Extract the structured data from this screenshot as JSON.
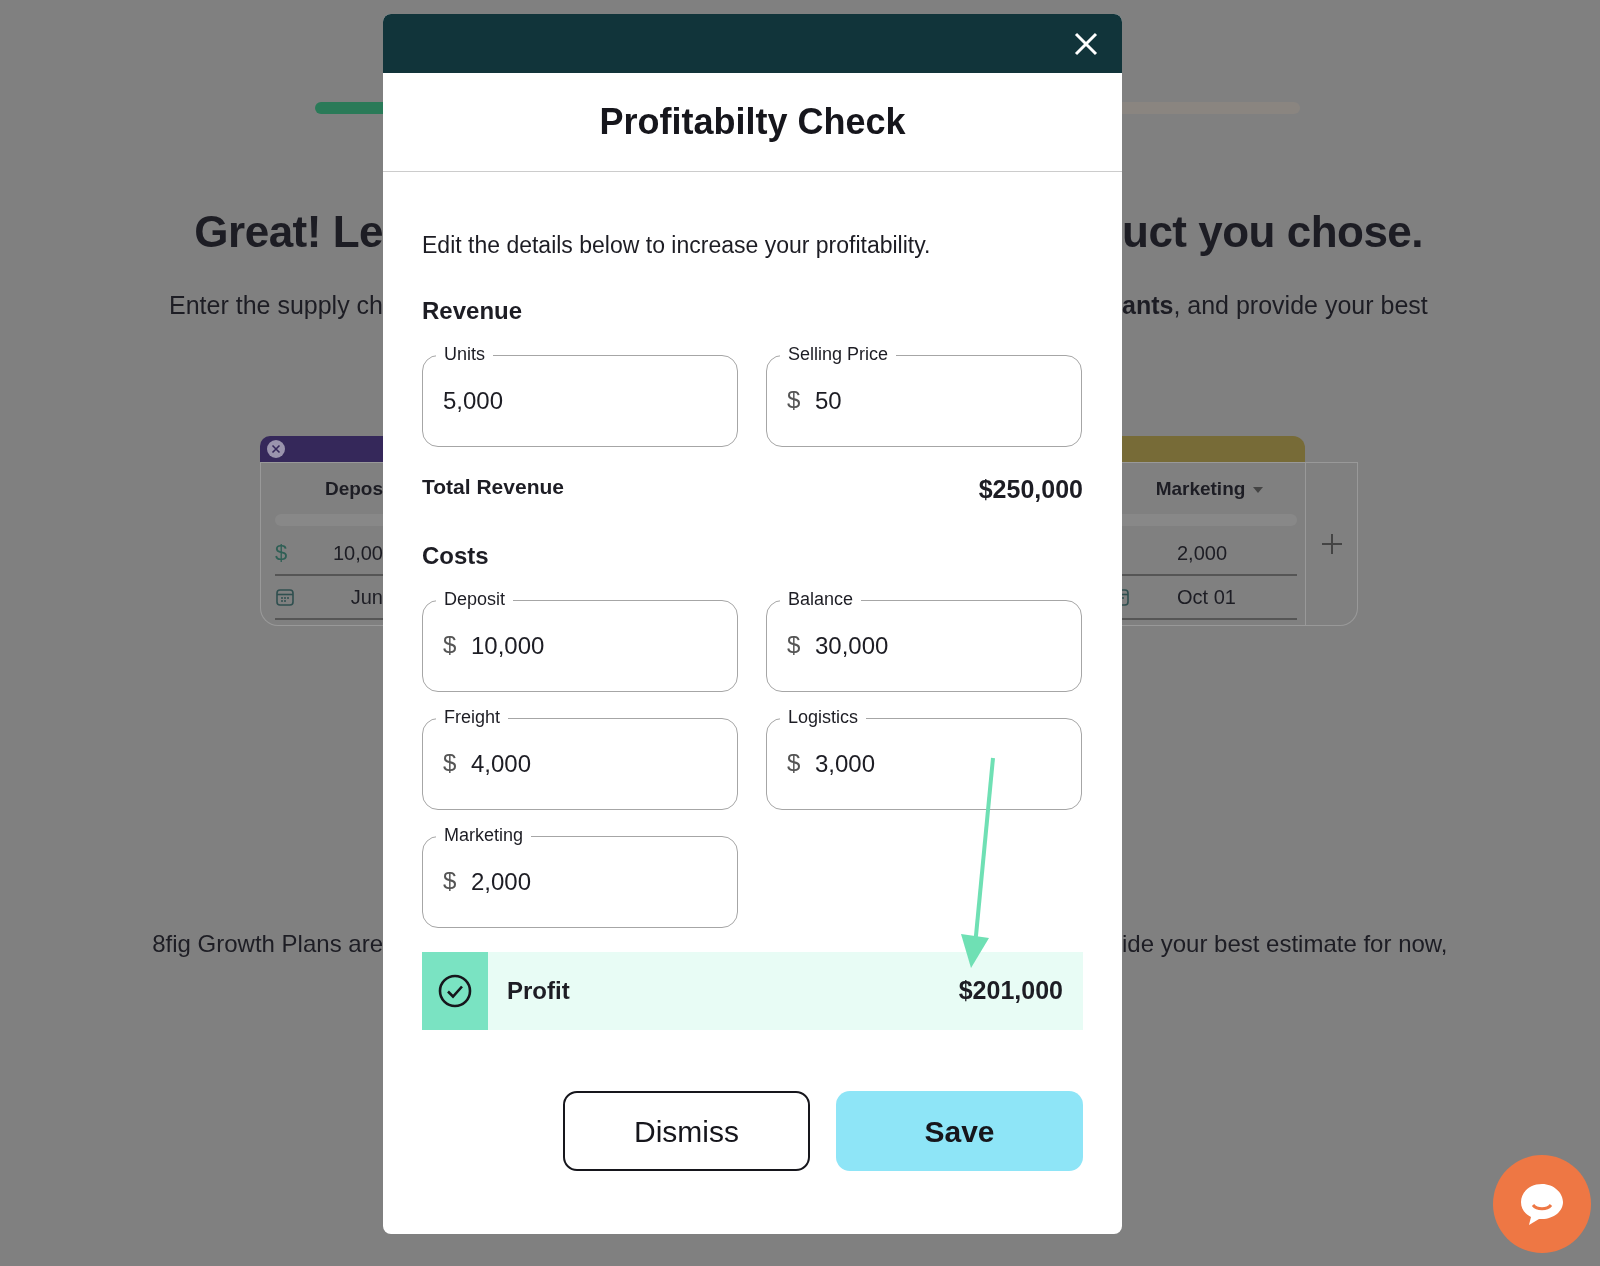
{
  "background": {
    "heading_left": "Great! Le",
    "heading_right": "uct you chose.",
    "subtitle_left": "Enter the supply ch",
    "subtitle_right": "**ants**, and provide your best",
    "footer_left": "8fig Growth Plans are",
    "footer_right": "ide your best estimate for now,",
    "card_left": {
      "column": "Depos",
      "currency": "$",
      "amount": "10,00",
      "date": "Jun"
    },
    "card_right": {
      "column": "Marketing",
      "amount": "2,000",
      "date": "Oct 01"
    }
  },
  "modal": {
    "title": "Profitabilty Check",
    "intro": "Edit the details below to increase your profitability.",
    "sections": [
      {
        "heading": "Revenue",
        "fields": [
          {
            "label": "Units",
            "value": "5,000"
          },
          {
            "label": "Selling Price",
            "prefix": "$",
            "value": "50"
          }
        ],
        "total": {
          "label": "Total Revenue",
          "value": "$250,000"
        }
      },
      {
        "heading": "Costs",
        "fields": [
          {
            "label": "Deposit",
            "prefix": "$",
            "value": "10,000"
          },
          {
            "label": "Balance",
            "prefix": "$",
            "value": "30,000"
          },
          {
            "label": "Freight",
            "prefix": "$",
            "value": "4,000"
          },
          {
            "label": "Logistics",
            "prefix": "$",
            "value": "3,000"
          },
          {
            "label": "Marketing",
            "prefix": "$",
            "value": "2,000"
          }
        ]
      }
    ],
    "profit": {
      "label": "Profit",
      "value": "$201,000"
    },
    "buttons": [
      {
        "label": "Dismiss",
        "kind": "outline"
      },
      {
        "label": "Save",
        "kind": "primary"
      }
    ]
  }
}
